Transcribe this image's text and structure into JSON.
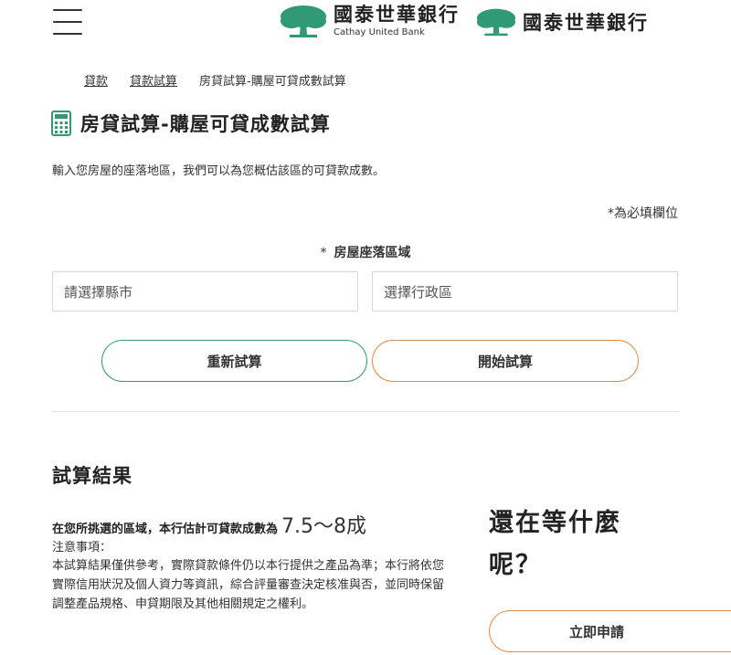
{
  "header": {
    "menu_icon": "hamburger-menu-icon",
    "logo_icon": "tree-logo-icon",
    "logo_name": "國泰世華銀行",
    "logo_sub": "Cathay United Bank",
    "logo_name_2": "國泰世華銀行",
    "brand_color": "#2f9a73"
  },
  "breadcrumb": {
    "items": [
      "貸款",
      "貸款試算",
      "房貸試算-購屋可貸成數試算"
    ]
  },
  "page": {
    "title_icon": "calculator-icon",
    "title": "房貸試算-購屋可貸成數試算",
    "description": "輸入您房屋的座落地區，我們可以為您概估該區的可貸款成數。",
    "required_note": "*為必填欄位"
  },
  "form": {
    "field_label_star": "*",
    "field_label": "房屋座落區域",
    "city_select": "請選擇縣市",
    "district_select": "選擇行政區",
    "reset_button": "重新試算",
    "start_button": "開始試算",
    "reset_color": "#2f9a73",
    "start_color": "#e38a45"
  },
  "result": {
    "title": "試算結果",
    "line_prefix": "在您所挑選的區域，本行估計可貸款成數為",
    "value": "7.5～8成",
    "notes_label": "注意事項：",
    "notes_body": "本試算結果僅供參考，實際貸款條件仍以本行提供之產品為準；本行將依您實際信用狀況及個人資力等資訊，綜合評量審查決定核准與否，並同時保留調整產品規格、申貸期限及其他相關規定之權利。"
  },
  "cta": {
    "title": "還在等什麼呢？",
    "apply_button": "立即申請"
  }
}
